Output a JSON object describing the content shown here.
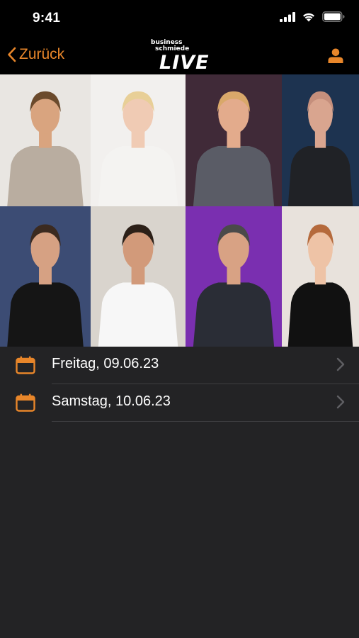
{
  "status_bar": {
    "time": "9:41"
  },
  "nav": {
    "back_label": "Zurück",
    "logo_line1": "business",
    "logo_line2": "schmiede",
    "logo_live": "LIVE"
  },
  "colors": {
    "accent": "#E8862A",
    "background": "#232325",
    "bar": "#000000",
    "separator": "#3d3d40"
  },
  "speaker_photos": [
    {
      "name": "speaker-photo-1",
      "bg": "#e9e6e2",
      "skin": "#d9a47f",
      "cloth": "#b9ada0",
      "hair": "#6b4a2c"
    },
    {
      "name": "speaker-photo-2",
      "bg": "#f2f0ee",
      "skin": "#f0cbb4",
      "cloth": "#f4f3f1",
      "hair": "#e8cf97"
    },
    {
      "name": "speaker-photo-3",
      "bg": "#402a38",
      "skin": "#e3ab8c",
      "cloth": "#5a5c66",
      "hair": "#d9a86a"
    },
    {
      "name": "speaker-photo-4",
      "bg": "#1d3350",
      "skin": "#d9a58f",
      "cloth": "#202226",
      "hair": "#c58f7c"
    },
    {
      "name": "speaker-photo-5",
      "bg": "#3c4c74",
      "skin": "#d6a183",
      "cloth": "#151515",
      "hair": "#3b2a20"
    },
    {
      "name": "speaker-photo-6",
      "bg": "#d9d4cd",
      "skin": "#d29a7a",
      "cloth": "#f7f7f7",
      "hair": "#2c2018"
    },
    {
      "name": "speaker-photo-7",
      "bg": "#7a2fb0",
      "skin": "#d8a284",
      "cloth": "#2a2d36",
      "hair": "#4a4a4a"
    },
    {
      "name": "speaker-photo-8",
      "bg": "#e8e2dc",
      "skin": "#eec3a6",
      "cloth": "#111111",
      "hair": "#b56a3c"
    }
  ],
  "days": [
    {
      "label": "Freitag, 09.06.23"
    },
    {
      "label": "Samstag, 10.06.23"
    }
  ]
}
